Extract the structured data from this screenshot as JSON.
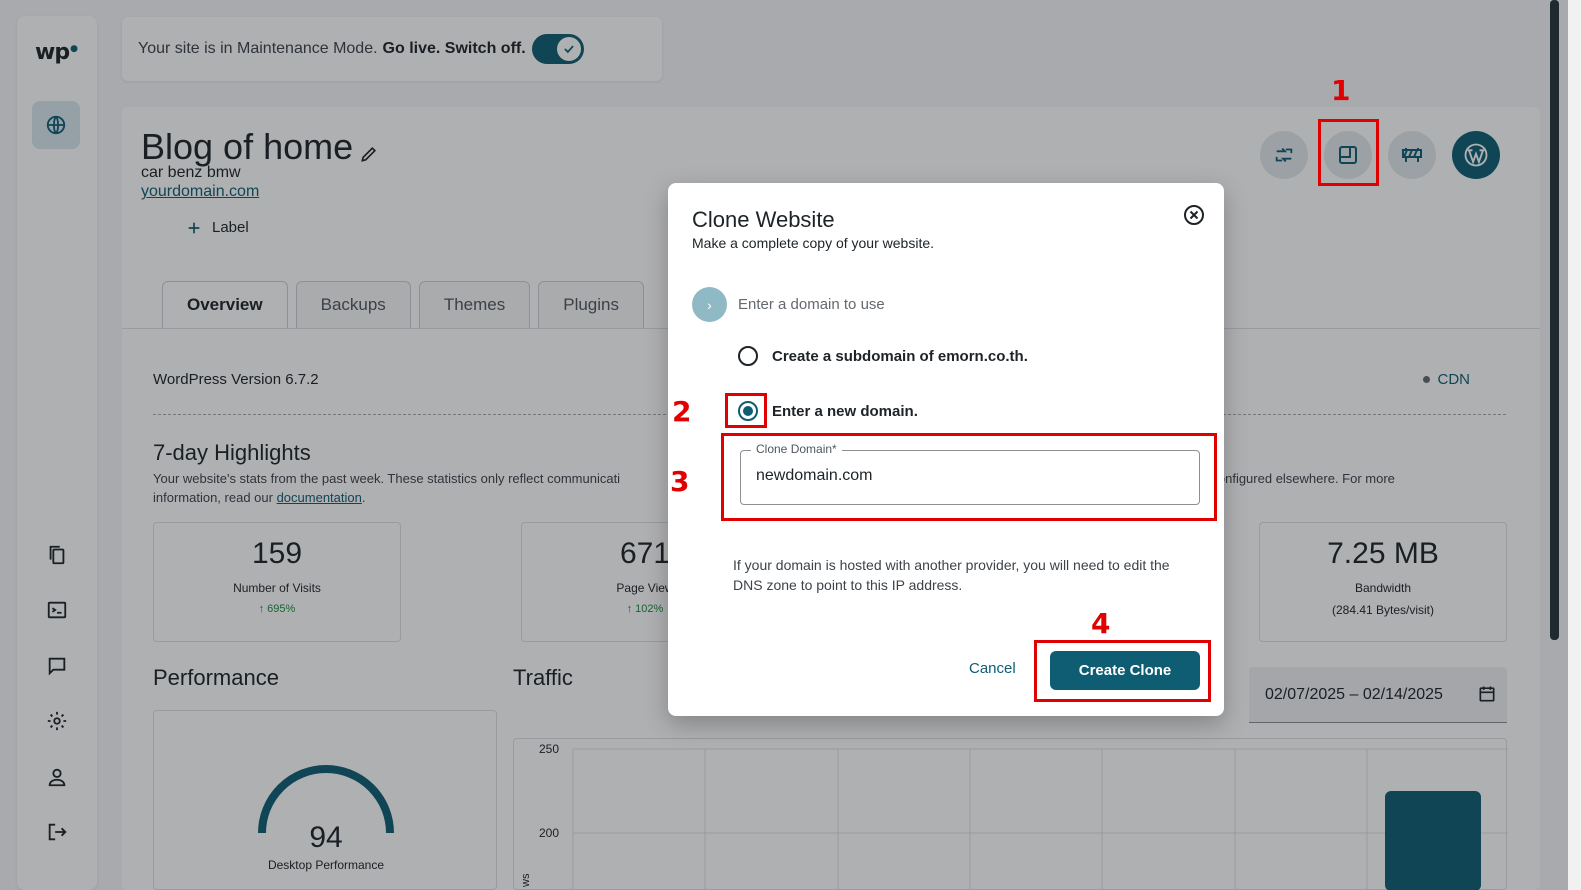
{
  "sidebar": {
    "logo": "wp",
    "items": [
      "globe-icon",
      "pages-icon",
      "terminal-icon",
      "comment-icon",
      "settings-icon",
      "user-icon",
      "logout-icon"
    ]
  },
  "banner": {
    "text": "Your site is in Maintenance Mode.",
    "action": "Go live. Switch off."
  },
  "site": {
    "title": "Blog of home",
    "subtitle": "car benz bmw",
    "url": "yourdomain.com",
    "add_label": "Label"
  },
  "tabs": [
    "Overview",
    "Backups",
    "Themes",
    "Plugins"
  ],
  "overview": {
    "wp_version": "WordPress Version 6.7.2",
    "cdn": "CDN",
    "highlights_title": "7-day Highlights",
    "highlights_desc_a": "Your website's stats from the past week. These statistics only reflect communicati",
    "highlights_desc_b": "Network configured elsewhere. For more",
    "highlights_desc_c": "information, read our",
    "highlights_link": "documentation",
    "stats": [
      {
        "value": "159",
        "label": "Number of Visits",
        "change": "695%"
      },
      {
        "value": "671",
        "label": "Page View",
        "change": "102%"
      },
      {
        "value": "7.25 MB",
        "label": "Bandwidth",
        "sub": "(284.41 Bytes/visit)"
      }
    ],
    "performance_title": "Performance",
    "traffic_title": "Traffic",
    "gauge_value": "94",
    "gauge_label": "Desktop Performance",
    "date_range": "02/07/2025 – 02/14/2025",
    "chart_ticks": [
      "250",
      "200"
    ],
    "chart_axis_label": "ws"
  },
  "modal": {
    "title": "Clone Website",
    "subtitle": "Make a complete copy of your website.",
    "step_label": "Enter a domain to use",
    "option_subdomain": "Create a subdomain of emorn.co.th.",
    "option_new_domain": "Enter a new domain.",
    "field_label": "Clone Domain*",
    "field_value": "newdomain.com",
    "note": "If your domain is hosted with another provider, you will need to edit the DNS zone to point to this IP address.",
    "cancel": "Cancel",
    "create": "Create Clone"
  },
  "annotations": [
    "1",
    "2",
    "3",
    "4"
  ],
  "colors": {
    "accent": "#0e5d73",
    "annotation": "#e00000"
  }
}
